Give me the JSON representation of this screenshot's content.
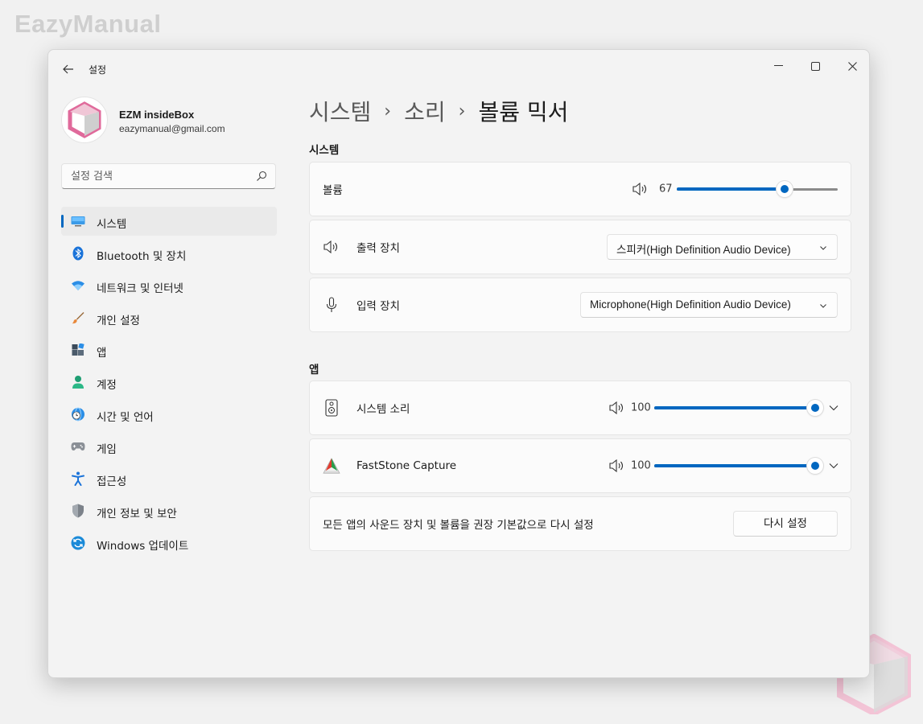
{
  "watermark": "EazyManual",
  "window": {
    "title": "설정"
  },
  "profile": {
    "name": "EZM insideBox",
    "email": "eazymanual@gmail.com"
  },
  "search": {
    "placeholder": "설정 검색"
  },
  "nav": [
    {
      "label": "시스템",
      "icon": "monitor-icon",
      "selected": true
    },
    {
      "label": "Bluetooth 및 장치",
      "icon": "bluetooth-icon"
    },
    {
      "label": "네트워크 및 인터넷",
      "icon": "wifi-icon"
    },
    {
      "label": "개인 설정",
      "icon": "brush-icon"
    },
    {
      "label": "앱",
      "icon": "apps-icon"
    },
    {
      "label": "계정",
      "icon": "person-icon"
    },
    {
      "label": "시간 및 언어",
      "icon": "globe-clock-icon"
    },
    {
      "label": "게임",
      "icon": "gamepad-icon"
    },
    {
      "label": "접근성",
      "icon": "accessibility-icon"
    },
    {
      "label": "개인 정보 및 보안",
      "icon": "shield-icon"
    },
    {
      "label": "Windows 업데이트",
      "icon": "update-icon"
    }
  ],
  "breadcrumb": {
    "item1": "시스템",
    "item2": "소리",
    "current": "볼륨 믹서",
    "separator": "›"
  },
  "system_section": {
    "title": "시스템",
    "volume": {
      "label": "볼륨",
      "value": 67
    },
    "output": {
      "label": "출력 장치",
      "value": "스피커(High Definition Audio Device)"
    },
    "input": {
      "label": "입력 장치",
      "value": "Microphone(High Definition Audio Device)"
    }
  },
  "apps_section": {
    "title": "앱",
    "apps": [
      {
        "name": "시스템 소리",
        "volume": 100,
        "icon": "speaker-icon"
      },
      {
        "name": "FastStone Capture",
        "volume": 100,
        "icon": "faststone-icon"
      }
    ],
    "reset": {
      "label": "모든 앱의 사운드 장치 및 볼륨을 권장 기본값으로 다시 설정",
      "button": "다시 설정"
    }
  },
  "colors": {
    "accent": "#0067c0",
    "logo_pink": "#e06a9b"
  }
}
